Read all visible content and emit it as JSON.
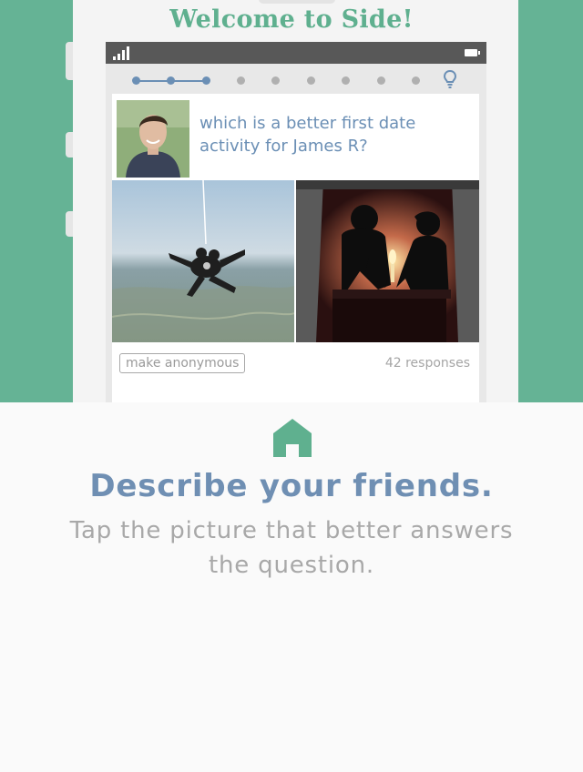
{
  "app": {
    "welcome_title": "Welcome to Side!"
  },
  "onboarding": {
    "total_steps": 9,
    "current_step": 3
  },
  "question_card": {
    "question": "which is a better first date activity for James R?",
    "options": [
      {
        "name": "skydiving-photo"
      },
      {
        "name": "candlelit-dinner-photo"
      }
    ],
    "anonymous_label": "make anonymous",
    "responses_label": "42 responses"
  },
  "footer": {
    "icon": "home-icon",
    "headline": "Describe your friends.",
    "subline": "Tap the picture that better answers the question."
  },
  "colors": {
    "brand_green": "#65b395",
    "accent_blue": "#6b8fb5",
    "muted_gray": "#a8a8a8"
  }
}
